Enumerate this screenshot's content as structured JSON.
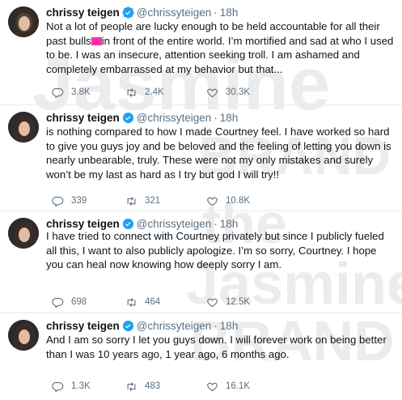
{
  "watermark": {
    "jasmine": "Jasmine",
    "brand": "BRAND",
    "the": "the",
    "color": "#e9e9e9"
  },
  "tweets": [
    {
      "name": "chrissy teigen",
      "handle": "@chrissyteigen",
      "time": "18h",
      "text_before": "Not a lot of people are lucky enough to be held accountable for all their past bulls",
      "text_after": "in front of the entire world. I’m mortified and sad at who I used to be. I was an insecure, attention seeking troll. I am ashamed and completely embarrassed at my behavior but that...",
      "replies": "3.8K",
      "retweets": "2.4K",
      "likes": "30.3K"
    },
    {
      "name": "chrissy teigen",
      "handle": "@chrissyteigen",
      "time": "18h",
      "text": "is nothing compared to how I made Courtney feel. I have worked so hard to give you guys joy and be beloved and the feeling of letting you down is nearly unbearable, truly. These were not my only mistakes and surely won’t be my last as hard as I try but god I will try!!",
      "replies": "339",
      "retweets": "321",
      "likes": "10.8K"
    },
    {
      "name": "chrissy teigen",
      "handle": "@chrissyteigen",
      "time": "18h",
      "text": "I have tried to connect with Courtney privately but since I publicly fueled all this, I want to also publicly apologize. I’m so sorry, Courtney. I hope you can heal now knowing how deeply sorry I am.",
      "replies": "698",
      "retweets": "464",
      "likes": "12.5K"
    },
    {
      "name": "chrissy teigen",
      "handle": "@chrissyteigen",
      "time": "18h",
      "text": "And I am so sorry I let you guys down. I will forever work on being better than I was 10 years ago, 1 year ago, 6 months ago.",
      "replies": "1.3K",
      "retweets": "483",
      "likes": "16.1K"
    }
  ],
  "icons": {
    "verified": "verified-badge-icon",
    "reply": "reply-icon",
    "retweet": "retweet-icon",
    "like": "heart-icon"
  },
  "colors": {
    "verified": "#1da1f2",
    "secondary_text": "#5b7083",
    "redaction": "#ff2ea6",
    "divider": "#e6ecf0"
  }
}
